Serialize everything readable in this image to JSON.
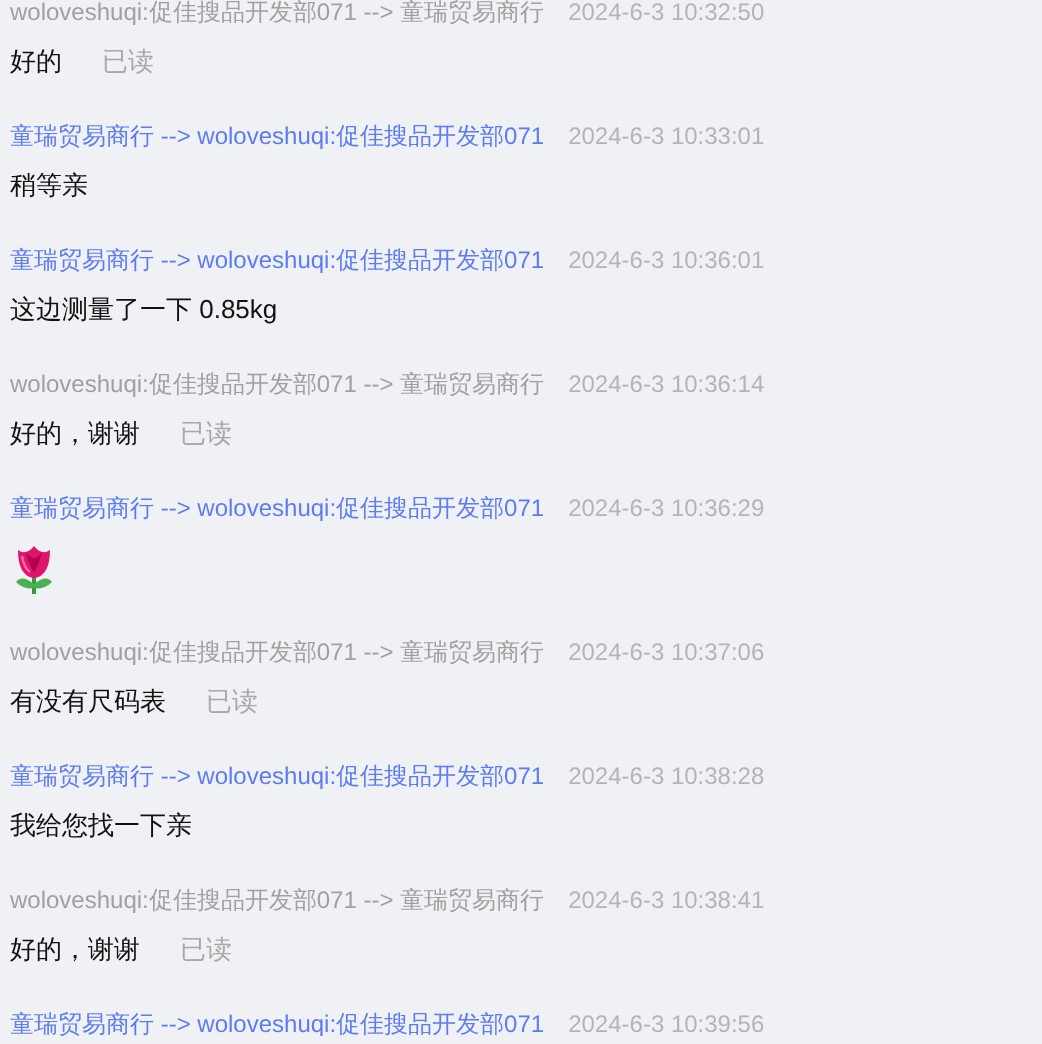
{
  "messages": [
    {
      "outgoing": true,
      "header": "woloveshuqi:促佳搜品开发部071 --> 童瑞贸易商行",
      "time": "2024-6-3 10:32:50",
      "kind": "text",
      "text": "好的",
      "status": "已读"
    },
    {
      "outgoing": false,
      "header": "童瑞贸易商行 --> woloveshuqi:促佳搜品开发部071",
      "time": "2024-6-3 10:33:01",
      "kind": "text",
      "text": "稍等亲"
    },
    {
      "outgoing": false,
      "header": "童瑞贸易商行 --> woloveshuqi:促佳搜品开发部071",
      "time": "2024-6-3 10:36:01",
      "kind": "text",
      "text": "这边测量了一下 0.85kg"
    },
    {
      "outgoing": true,
      "header": "woloveshuqi:促佳搜品开发部071 --> 童瑞贸易商行",
      "time": "2024-6-3 10:36:14",
      "kind": "text",
      "text": "好的，谢谢",
      "status": "已读"
    },
    {
      "outgoing": false,
      "header": "童瑞贸易商行 --> woloveshuqi:促佳搜品开发部071",
      "time": "2024-6-3 10:36:29",
      "kind": "sticker"
    },
    {
      "outgoing": true,
      "header": "woloveshuqi:促佳搜品开发部071 --> 童瑞贸易商行",
      "time": "2024-6-3 10:37:06",
      "kind": "text",
      "text": "有没有尺码表",
      "status": "已读"
    },
    {
      "outgoing": false,
      "header": "童瑞贸易商行 --> woloveshuqi:促佳搜品开发部071",
      "time": "2024-6-3 10:38:28",
      "kind": "text",
      "text": "我给您找一下亲"
    },
    {
      "outgoing": true,
      "header": "woloveshuqi:促佳搜品开发部071 --> 童瑞贸易商行",
      "time": "2024-6-3 10:38:41",
      "kind": "text",
      "text": "好的，谢谢",
      "status": "已读"
    },
    {
      "outgoing": false,
      "header": "童瑞贸易商行 --> woloveshuqi:促佳搜品开发部071",
      "time": "2024-6-3 10:39:56"
    }
  ]
}
